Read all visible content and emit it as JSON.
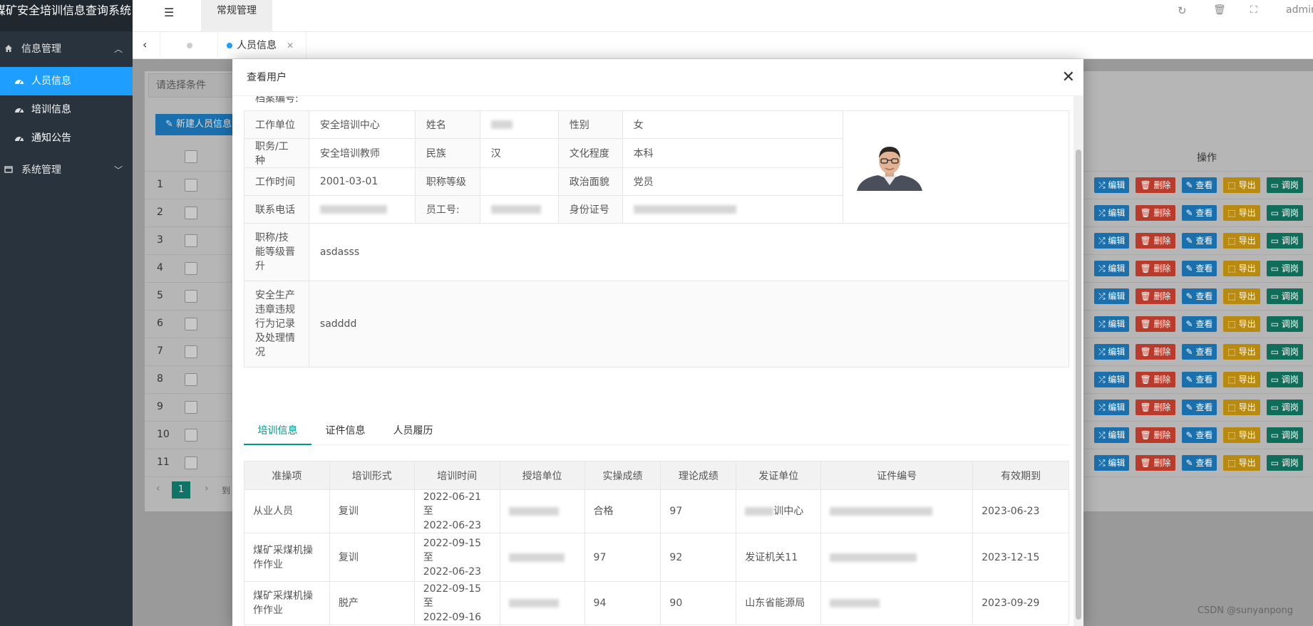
{
  "app": {
    "title": "煤矿安全培训信息查询系统"
  },
  "sidebar": {
    "groups": [
      {
        "label": "信息管理",
        "items": [
          {
            "label": "人员信息"
          },
          {
            "label": "培训信息"
          },
          {
            "label": "通知公告"
          }
        ]
      },
      {
        "label": "系统管理"
      }
    ]
  },
  "topbar": {
    "active_menu": "常规管理",
    "user": "admin"
  },
  "tabs": [
    {
      "label": "人员信息"
    }
  ],
  "background": {
    "filter_placeholder": "请选择条件",
    "new_button": "新建人员信息",
    "ops_header": "操作",
    "row_numbers": [
      "1",
      "2",
      "3",
      "4",
      "5",
      "6",
      "7",
      "8",
      "9",
      "10",
      "11"
    ],
    "ops_labels": {
      "edit": "编辑",
      "delete": "删除",
      "view": "查看",
      "export": "导出",
      "adjust": "调岗"
    },
    "page_current": "1",
    "page_goto": "到"
  },
  "modal": {
    "title": "查看用户",
    "cut_label": "档案编号:",
    "fields": {
      "work_unit_label": "工作单位",
      "work_unit": "安全培训中心",
      "name_label": "姓名",
      "gender_label": "性别",
      "gender": "女",
      "job_label": "职务/工种",
      "job": "安全培训教师",
      "ethnicity_label": "民族",
      "ethnicity": "汉",
      "education_label": "文化程度",
      "education": "本科",
      "work_time_label": "工作时间",
      "work_time": "2001-03-01",
      "title_level_label": "职称等级",
      "title_level": "",
      "political_label": "政治面貌",
      "political": "党员",
      "phone_label": "联系电话",
      "emp_no_label": "员工号:",
      "id_label": "身份证号",
      "promotion_label": "职称/技能等级晋升",
      "promotion": "asdasss",
      "violation_label": "安全生产违章违规行为记录及处理情况",
      "violation": "sadddd"
    },
    "tabs": [
      "培训信息",
      "证件信息",
      "人员履历"
    ],
    "table": {
      "headers": [
        "准操项",
        "培训形式",
        "培训时间",
        "授培单位",
        "实操成绩",
        "理论成绩",
        "发证单位",
        "证件编号",
        "有效期到"
      ],
      "rows": [
        {
          "item": "从业人员",
          "form": "复训",
          "time_start": "2022-06-21至",
          "time_end": "2022-06-23",
          "practical": "合格",
          "theory": "97",
          "issuer": "训中心",
          "expiry": "2023-06-23"
        },
        {
          "item": "煤矿采煤机操作作业",
          "form": "复训",
          "time_start": "2022-09-15至",
          "time_end": "2022-06-23",
          "practical": "97",
          "theory": "92",
          "issuer": "发证机关11",
          "expiry": "2023-12-15"
        },
        {
          "item": "煤矿采煤机操作作业",
          "form": "脱产",
          "time_start": "2022-09-15至",
          "time_end": "2022-09-16",
          "practical": "94",
          "theory": "90",
          "issuer": "山东省能源局",
          "expiry": "2023-09-29"
        }
      ]
    }
  },
  "watermark": "CSDN @sunyanpong"
}
